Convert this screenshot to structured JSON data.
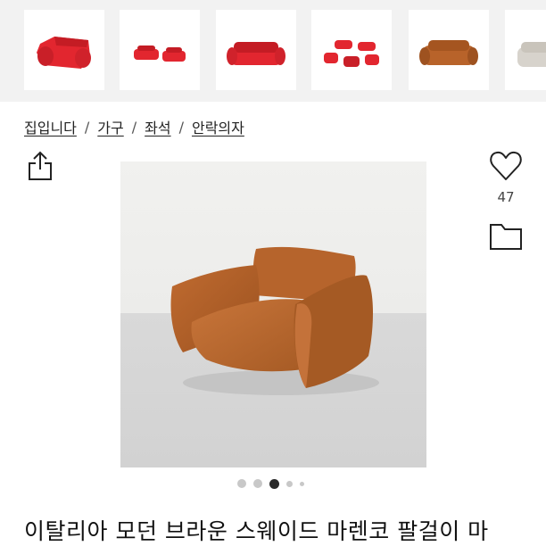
{
  "thumbnails": [
    {
      "alt": "red-sofa-icon",
      "color": "#e2262f"
    },
    {
      "alt": "red-sofa-icon",
      "color": "#e2262f"
    },
    {
      "alt": "red-sofa-icon",
      "color": "#e2262f"
    },
    {
      "alt": "red-sofa-icon",
      "color": "#e2262f"
    },
    {
      "alt": "brown-sofa-icon",
      "color": "#b8632a"
    },
    {
      "alt": "gray-sofa-icon",
      "color": "#d7d3cc"
    }
  ],
  "breadcrumb": {
    "items": [
      "집입니다",
      "가구",
      "좌석",
      "안락의자"
    ],
    "separator": "/"
  },
  "actions": {
    "like_count": "47"
  },
  "product": {
    "title": "이탈리아 모던 브라운 스웨이드 마렌코 팔걸이 마",
    "image_color": "#b5652c"
  },
  "carousel": {
    "dot_count": 5,
    "active_index": 2
  }
}
